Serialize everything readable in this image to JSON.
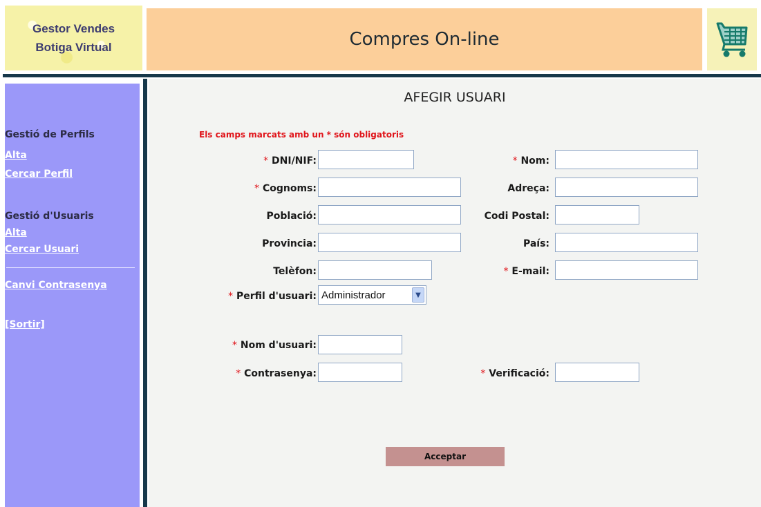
{
  "header": {
    "logo_line1": "Gestor Vendes",
    "logo_line2": "Botiga Virtual",
    "title": "Compres On-line",
    "cart_icon": "shopping-cart-icon"
  },
  "sidebar": {
    "profiles_heading": "Gestió de Perfils",
    "profiles_alta": "Alta",
    "profiles_search": "Cercar Perfil",
    "users_heading": "Gestió d'Usuaris",
    "users_alta": "Alta",
    "users_search": "Cercar Usuari",
    "change_password": "Canvi Contrasenya",
    "logout": "[Sortir]"
  },
  "form": {
    "page_title": "AFEGIR USUARI",
    "required_note": "Els camps marcats amb un * són obligatoris",
    "star": "*",
    "labels": {
      "dni": "DNI/NIF:",
      "nom": "Nom:",
      "cognoms": "Cognoms:",
      "adreca": "Adreça:",
      "poblacio": "Població:",
      "codi_postal": "Codi Postal:",
      "provincia": "Provincia:",
      "pais": "País:",
      "telefon": "Telèfon:",
      "email": "E-mail:",
      "perfil": "Perfil d'usuari:",
      "nom_usuari": "Nom d'usuari:",
      "contrasenya": "Contrasenya:",
      "verificacio": "Verificació:"
    },
    "values": {
      "dni": "",
      "nom": "",
      "cognoms": "",
      "adreca": "",
      "poblacio": "",
      "codi_postal": "",
      "provincia": "",
      "pais": "",
      "telefon": "",
      "email": "",
      "nom_usuari": "",
      "contrasenya": "",
      "verificacio": ""
    },
    "perfil_selected": "Administrador",
    "accept_label": "Acceptar"
  },
  "colors": {
    "sidebar_bg": "#9b98f9",
    "title_bar_bg": "#fccf9a",
    "required_red": "#e0141a",
    "accept_btn_bg": "#c49190",
    "rule_dark": "#17384a"
  }
}
